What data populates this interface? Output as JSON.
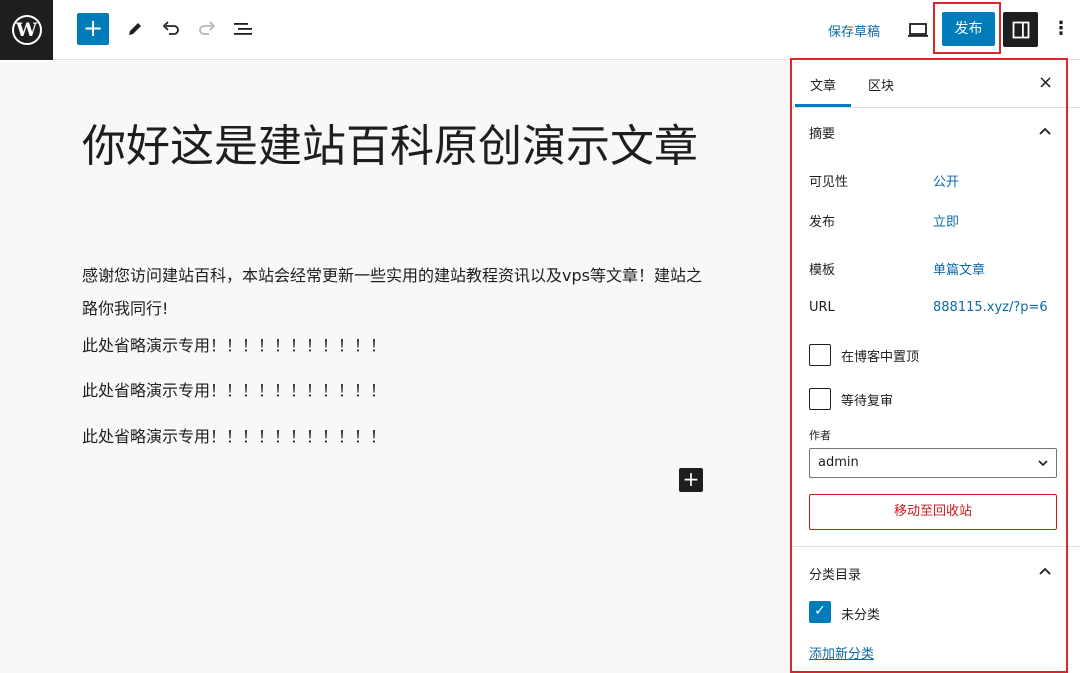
{
  "toolbar": {
    "add_label": "+",
    "save_draft": "保存草稿",
    "publish": "发布",
    "more": "⋮",
    "logo_glyph": "W",
    "icons": [
      "wordpress-logo-icon",
      "plus-icon",
      "pencil-icon",
      "undo-icon",
      "redo-icon",
      "list-view-icon",
      "preview-laptop-icon",
      "sidebar-toggle-icon",
      "more-options-icon"
    ]
  },
  "post": {
    "title": "你好这是建站百科原创演示文章",
    "paragraphs": [
      "感谢您访问建站百科，本站会经常更新一些实用的建站教程资讯以及vps等文章！建站之路你我同行!",
      "此处省略演示专用！！！！！！！！！！！",
      "此处省略演示专用！！！！！！！！！！！",
      "此处省略演示专用！！！！！！！！！！！"
    ],
    "inline_add": "+"
  },
  "sidebar": {
    "tabs": [
      "文章",
      "区块"
    ],
    "active_tab": "文章",
    "close": "×",
    "summary": {
      "title": "摘要",
      "rows": [
        {
          "label": "可见性",
          "value": "公开"
        },
        {
          "label": "发布",
          "value": "立即"
        },
        {
          "label": "模板",
          "value": "单篇文章"
        },
        {
          "label": "URL",
          "value": "888115.xyz/?p=6"
        }
      ],
      "checkboxes": [
        {
          "label": "在博客中置顶",
          "checked": false
        },
        {
          "label": "等待复审",
          "checked": false
        }
      ],
      "author_label": "作者",
      "author_value": "admin",
      "trash": "移动至回收站"
    },
    "categories": {
      "title": "分类目录",
      "items": [
        {
          "label": "未分类",
          "checked": true
        }
      ],
      "add_new": "添加新分类"
    }
  },
  "colors": {
    "accent": "#007cba",
    "link": "#0b6aa6",
    "highlight_border": "#d9262c",
    "danger": "#cc1818",
    "dark": "#1e1e1e"
  }
}
